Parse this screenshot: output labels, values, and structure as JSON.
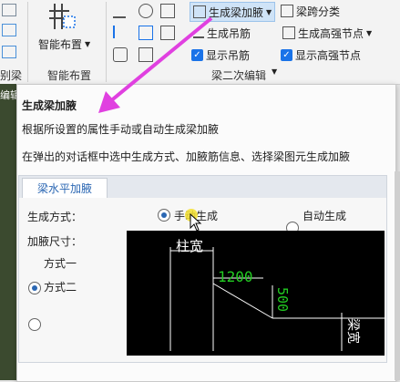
{
  "ribbon": {
    "left_group_labels": [
      "别梁",
      "编辑"
    ],
    "smart_layout": {
      "label": "智能布置",
      "group_label": "智能布置"
    },
    "generate_haunch": "生成梁加腋",
    "span_class": "梁跨分类",
    "generate_hanger": "生成吊筋",
    "generate_high_strength_node": "生成高强节点",
    "show_hanger": "显示吊筋",
    "show_high_strength_node": "显示高强节点",
    "secondary_edit_group": "梁二次编辑"
  },
  "tooltip": {
    "title": "生成梁加腋",
    "desc1": "根据所设置的属性手动或自动生成梁加腋",
    "desc2": "在弹出的对话框中选中生成方式、加腋筋信息、选择梁图元生成加腋",
    "tab": "梁水平加腋",
    "gen_mode_label": "生成方式：",
    "manual": "手动生成",
    "auto": "自动生成",
    "size_label": "加腋尺寸：",
    "mode1": "方式一",
    "mode2": "方式二",
    "diagram": {
      "col_width": "柱宽",
      "dim1": "1200",
      "dim2": "500",
      "beam_width": "梁宽"
    }
  },
  "colors": {
    "accent": "#2b67b3",
    "arrow": "#e040e0",
    "dim_green": "#22cc22"
  }
}
